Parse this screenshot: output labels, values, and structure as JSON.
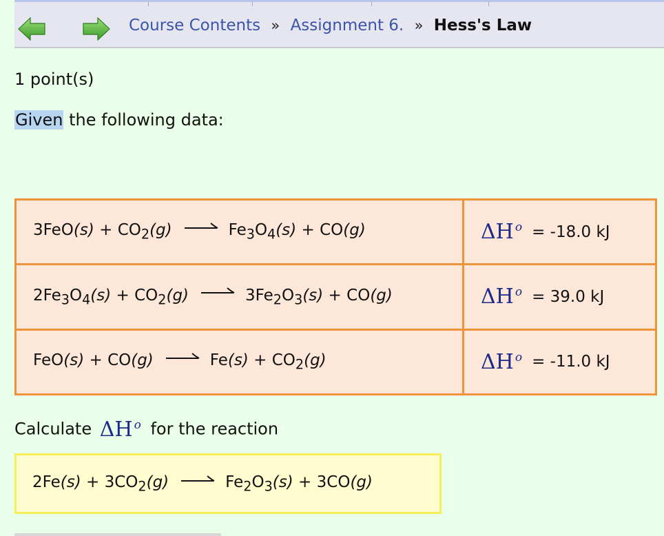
{
  "nav": {
    "back_icon": "left-arrow-icon",
    "forward_icon": "right-arrow-icon",
    "breadcrumb": {
      "course": "Course Contents",
      "sep1": "»",
      "assignment": "Assignment 6.",
      "sep2": "»",
      "current": "Hess's Law"
    }
  },
  "problem": {
    "points": "1 point(s)",
    "given_word": "Given",
    "given_rest": " the following data:"
  },
  "reactions": [
    {
      "lhs": [
        {
          "t": "3FeO"
        },
        {
          "t": "(s)",
          "i": 1
        },
        {
          "t": " + CO"
        },
        {
          "t": "2",
          "sub": 1
        },
        {
          "t": "(g)",
          "i": 1
        }
      ],
      "rhs": [
        {
          "t": "Fe"
        },
        {
          "t": "3",
          "sub": 1
        },
        {
          "t": "O"
        },
        {
          "t": "4",
          "sub": 1
        },
        {
          "t": "(s)",
          "i": 1
        },
        {
          "t": " + CO"
        },
        {
          "t": "(g)",
          "i": 1
        }
      ],
      "dh_symbol": "ΔH",
      "dh_deg": "o",
      "dh_value": "= -18.0 kJ"
    },
    {
      "lhs": [
        {
          "t": "2Fe"
        },
        {
          "t": "3",
          "sub": 1
        },
        {
          "t": "O"
        },
        {
          "t": "4",
          "sub": 1
        },
        {
          "t": "(s)",
          "i": 1
        },
        {
          "t": " + CO"
        },
        {
          "t": "2",
          "sub": 1
        },
        {
          "t": "(g)",
          "i": 1
        }
      ],
      "rhs": [
        {
          "t": "3Fe"
        },
        {
          "t": "2",
          "sub": 1
        },
        {
          "t": "O"
        },
        {
          "t": "3",
          "sub": 1
        },
        {
          "t": "(s)",
          "i": 1
        },
        {
          "t": " + CO"
        },
        {
          "t": "(g)",
          "i": 1
        }
      ],
      "dh_symbol": "ΔH",
      "dh_deg": "o",
      "dh_value": "= 39.0 kJ"
    },
    {
      "lhs": [
        {
          "t": "FeO"
        },
        {
          "t": "(s)",
          "i": 1
        },
        {
          "t": " + CO"
        },
        {
          "t": "(g)",
          "i": 1
        }
      ],
      "rhs": [
        {
          "t": "Fe"
        },
        {
          "t": "(s)",
          "i": 1
        },
        {
          "t": " + CO"
        },
        {
          "t": "2",
          "sub": 1
        },
        {
          "t": "(g)",
          "i": 1
        }
      ],
      "dh_symbol": "ΔH",
      "dh_deg": "o",
      "dh_value": "= -11.0 kJ"
    }
  ],
  "question": {
    "calc_prefix": "Calculate",
    "dh_symbol": "ΔH",
    "dh_deg": "o",
    "calc_suffix": "for the reaction"
  },
  "target": {
    "lhs": [
      {
        "t": "2Fe"
      },
      {
        "t": "(s)",
        "i": 1
      },
      {
        "t": " + 3CO"
      },
      {
        "t": "2",
        "sub": 1
      },
      {
        "t": "(g)",
        "i": 1
      }
    ],
    "rhs": [
      {
        "t": "Fe"
      },
      {
        "t": "2",
        "sub": 1
      },
      {
        "t": "O"
      },
      {
        "t": "3",
        "sub": 1
      },
      {
        "t": "(s)",
        "i": 1
      },
      {
        "t": " + 3CO"
      },
      {
        "t": "(g)",
        "i": 1
      }
    ]
  },
  "colors": {
    "page_bg": "#eaffea",
    "table_bg": "#fde7d9",
    "table_border": "#f0923a",
    "target_bg": "#fffcd0",
    "target_border": "#f6ef5a",
    "link": "#3b54a8",
    "nav_arrow": "#4caf32"
  }
}
